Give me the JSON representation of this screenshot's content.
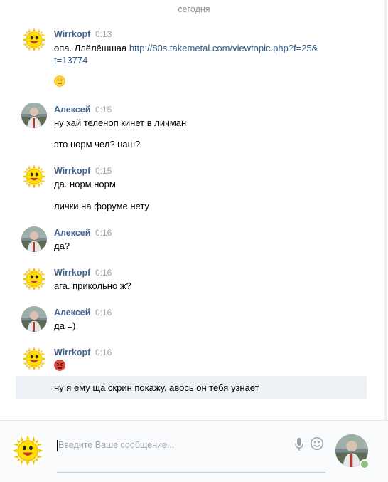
{
  "date_separator": "сегодня",
  "colors": {
    "author": "#42648b",
    "link": "#2a5885",
    "highlight": "#edf0f5",
    "online": "#8ac176"
  },
  "messages": [
    {
      "author": "Wirrkopf",
      "time": "0:13",
      "avatar": "sun-avatar",
      "lines": [
        "опа. Ллёлёшшаа ",
        "t=13774"
      ],
      "link_part1": "http://80s.takemetal.com/viewtopic.php?f=25&",
      "emoji": "neutral-face-emoji"
    },
    {
      "author": "Алексей",
      "time": "0:15",
      "avatar": "photo-avatar",
      "lines": [
        "ну хай теленоп кинет в личман",
        "это норм чел? наш?"
      ]
    },
    {
      "author": "Wirrkopf",
      "time": "0:15",
      "avatar": "sun-avatar",
      "lines": [
        "да. норм норм",
        "лички на форуме нету"
      ]
    },
    {
      "author": "Алексей",
      "time": "0:16",
      "avatar": "photo-avatar",
      "lines": [
        "да?"
      ]
    },
    {
      "author": "Wirrkopf",
      "time": "0:16",
      "avatar": "sun-avatar",
      "lines": [
        "ага. прикольно ж?"
      ]
    },
    {
      "author": "Алексей",
      "time": "0:16",
      "avatar": "photo-avatar",
      "lines": [
        "да =)"
      ]
    },
    {
      "author": "Wirrkopf",
      "time": "0:16",
      "avatar": "sun-avatar",
      "emoji": "angry-face-emoji",
      "lines": [
        "ну я ему ща скрин покажу. авось он тебя узнает"
      ]
    }
  ],
  "composer": {
    "placeholder": "Введите Ваше сообщение...",
    "mic_icon": "microphone-icon",
    "smile_icon": "emoji-icon"
  }
}
